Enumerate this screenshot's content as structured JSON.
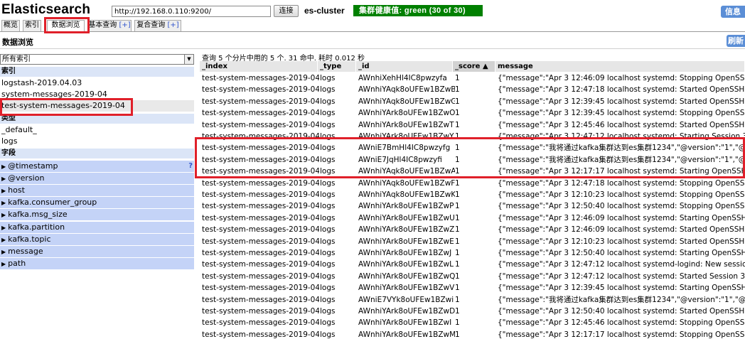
{
  "header": {
    "app_title": "Elasticsearch",
    "url_value": "http://192.168.0.110:9200/",
    "connect_label": "连接",
    "cluster_name": "es-cluster",
    "health": "集群健康值: green (30 of 30)",
    "info_label": "信息"
  },
  "tabs": [
    {
      "label": "概览"
    },
    {
      "label": "索引"
    },
    {
      "label": "数据浏览"
    },
    {
      "label": "基本查询",
      "plus": "[+]"
    },
    {
      "label": "复合查询",
      "plus": "[+]"
    }
  ],
  "subheader": {
    "title": "数据浏览",
    "refresh_label": "刷新"
  },
  "sidebar": {
    "index_select": "所有索引",
    "indices_label": "索引",
    "indices": [
      "logstash-2019.04.03",
      "system-messages-2019-04",
      "test-system-messages-2019-04"
    ],
    "types_label": "类型",
    "types": [
      "_default_",
      "logs"
    ],
    "fields_label": "字段",
    "fields": [
      "@timestamp",
      "@version",
      "host",
      "kafka.consumer_group",
      "kafka.msg_size",
      "kafka.partition",
      "kafka.topic",
      "message",
      "path"
    ],
    "help_mark": "?"
  },
  "results": {
    "summary": "查询 5 个分片中用的 5 个. 31 命中. 耗时 0.012 秒",
    "columns": [
      "_index",
      "_type",
      "_id",
      "_score ▲",
      "message"
    ],
    "rows": [
      [
        "test-system-messages-2019-04",
        "logs",
        "AWnhiXehHl4IC8pwzyfa",
        "1",
        "{\"message\":\"Apr 3 12:46:09 localhost systemd: Stopping OpenSSH se"
      ],
      [
        "test-system-messages-2019-04",
        "logs",
        "AWnhiYAqk8oUFEw1BZwB",
        "1",
        "{\"message\":\"Apr 3 12:47:18 localhost systemd: Started OpenSSH ser"
      ],
      [
        "test-system-messages-2019-04",
        "logs",
        "AWnhiYAqk8oUFEw1BZwG",
        "1",
        "{\"message\":\"Apr 3 12:39:45 localhost systemd: Started OpenSSH ser"
      ],
      [
        "test-system-messages-2019-04",
        "logs",
        "AWnhiYArk8oUFEw1BZwO",
        "1",
        "{\"message\":\"Apr 3 12:39:45 localhost systemd: Stopping OpenSSH se"
      ],
      [
        "test-system-messages-2019-04",
        "logs",
        "AWnhiYArk8oUFEw1BZwT",
        "1",
        "{\"message\":\"Apr 3 12:45:46 localhost systemd: Started OpenSSH ser"
      ],
      [
        "test-system-messages-2019-04",
        "logs",
        "AWnhiYArk8oUFEw1BZwY",
        "1",
        "{\"message\":\"Apr 3 12:47:12 localhost systemd: Starting Session 32"
      ],
      [
        "test-system-messages-2019-04",
        "logs",
        "AWniE7BmHl4IC8pwzyfg",
        "1",
        "{\"message\":\"我将通过kafka集群达到es集群1234\",\"@version\":\"1\",\"@time"
      ],
      [
        "test-system-messages-2019-04",
        "logs",
        "AWniE7JqHl4IC8pwzyfi",
        "1",
        "{\"message\":\"我将通过kafka集群达到es集群1234\",\"@version\":\"1\",\"@time"
      ],
      [
        "test-system-messages-2019-04",
        "logs",
        "AWnhiYAqk8oUFEw1BZwA",
        "1",
        "{\"message\":\"Apr 3 12:17:17 localhost systemd: Starting OpenSSH se"
      ],
      [
        "test-system-messages-2019-04",
        "logs",
        "AWnhiYAqk8oUFEw1BZwF",
        "1",
        "{\"message\":\"Apr 3 12:47:18 localhost systemd: Stopping OpenSSH se"
      ],
      [
        "test-system-messages-2019-04",
        "logs",
        "AWnhiYAqk8oUFEw1BZwK",
        "1",
        "{\"message\":\"Apr 3 12:10:23 localhost systemd: Stopping OpenSSH se"
      ],
      [
        "test-system-messages-2019-04",
        "logs",
        "AWnhiYArk8oUFEw1BZwP",
        "1",
        "{\"message\":\"Apr 3 12:50:40 localhost systemd: Stopping OpenSSH se"
      ],
      [
        "test-system-messages-2019-04",
        "logs",
        "AWnhiYArk8oUFEw1BZwU",
        "1",
        "{\"message\":\"Apr 3 12:46:09 localhost systemd: Starting OpenSSH se"
      ],
      [
        "test-system-messages-2019-04",
        "logs",
        "AWnhiYArk8oUFEw1BZwZ",
        "1",
        "{\"message\":\"Apr 3 12:46:09 localhost systemd: Started OpenSSH ser"
      ],
      [
        "test-system-messages-2019-04",
        "logs",
        "AWnhiYArk8oUFEw1BZwE",
        "1",
        "{\"message\":\"Apr 3 12:10:23 localhost systemd: Started OpenSSH ser"
      ],
      [
        "test-system-messages-2019-04",
        "logs",
        "AWnhiYArk8oUFEw1BZwJ",
        "1",
        "{\"message\":\"Apr 3 12:50:40 localhost systemd: Starting OpenSSH se"
      ],
      [
        "test-system-messages-2019-04",
        "logs",
        "AWnhiYArk8oUFEw1BZwL",
        "1",
        "{\"message\":\"Apr 3 12:47:12 localhost systemd-logind: New session 3"
      ],
      [
        "test-system-messages-2019-04",
        "logs",
        "AWnhiYArk8oUFEw1BZwQ",
        "1",
        "{\"message\":\"Apr 3 12:47:12 localhost systemd: Started Session 32 of"
      ],
      [
        "test-system-messages-2019-04",
        "logs",
        "AWnhiYArk8oUFEw1BZwV",
        "1",
        "{\"message\":\"Apr 3 12:39:45 localhost systemd: Starting OpenSSH se"
      ],
      [
        "test-system-messages-2019-04",
        "logs",
        "AWniE7VYk8oUFEw1BZwi",
        "1",
        "{\"message\":\"我将通过kafka集群达到es集群1234\",\"@version\":\"1\",\"@time"
      ],
      [
        "test-system-messages-2019-04",
        "logs",
        "AWnhiYArk8oUFEw1BZwD",
        "1",
        "{\"message\":\"Apr 3 12:50:40 localhost systemd: Started OpenSSH ser"
      ],
      [
        "test-system-messages-2019-04",
        "logs",
        "AWnhiYArk8oUFEw1BZwI",
        "1",
        "{\"message\":\"Apr 3 12:45:46 localhost systemd: Stopping OpenSSH se"
      ],
      [
        "test-system-messages-2019-04",
        "logs",
        "AWnhiYArk8oUFEw1BZwM",
        "1",
        "{\"message\":\"Apr 3 12:17:17 localhost systemd: Stopping OpenSSH se"
      ]
    ]
  },
  "colors": {
    "health_green": "#008000",
    "highlight_red": "#e0202a",
    "field_blue": "#c4d3f7",
    "section_blue": "#dbe5f7",
    "button_blue": "#5b8ed6"
  },
  "icons": {
    "select_arrow": "chevron-down-icon",
    "field_toggle": "triangle-right-icon",
    "sort": "sort-ascending-icon"
  }
}
